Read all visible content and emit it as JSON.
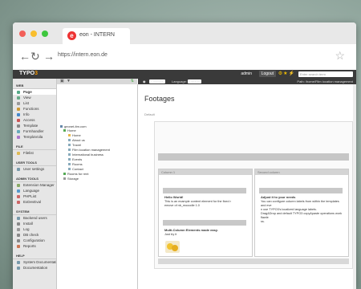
{
  "browser": {
    "tab_title": "eon - INTERN",
    "tab_icon": "e",
    "url": "https://intern.eon.de"
  },
  "typo3": {
    "logo_prefix": "TYPO",
    "logo_suffix": "3",
    "user": "admin",
    "logout": "Logout",
    "search_placeholder": "Enter search term"
  },
  "sidebar": {
    "sections": [
      {
        "title": "WEB",
        "items": [
          "Page",
          "View",
          "List",
          "Functions",
          "Info",
          "Access",
          "Template",
          "Formhandler",
          "TemplaVoila"
        ]
      },
      {
        "title": "FILE",
        "items": [
          "Filelist"
        ]
      },
      {
        "title": "USER TOOLS",
        "items": [
          "User settings"
        ]
      },
      {
        "title": "ADMIN TOOLS",
        "items": [
          "Extension Manager",
          "Language",
          "PHPList",
          "ExDevEval"
        ]
      },
      {
        "title": "SYSTEM",
        "items": [
          "Backend users",
          "Install",
          "Log",
          "DB check",
          "Configuration",
          "Reports"
        ]
      },
      {
        "title": "HELP",
        "items": [
          "System Documentation",
          "Documentation"
        ]
      }
    ]
  },
  "tree": {
    "nodes": [
      "geonet-itm.com",
      "Home",
      "Home",
      "About us",
      "Travel",
      "Film location management",
      "International business",
      "Events",
      "Rooms",
      "Contact",
      "Rooms for rent",
      "Storage"
    ]
  },
  "docheader": {
    "columns": "Columns",
    "language_label": "Language:",
    "language_value": "Default",
    "path": "Path: /home/Film location management"
  },
  "page": {
    "title": "Footages",
    "default_label": "Default",
    "col1_header": "Column 1",
    "col2_header": "Second column",
    "col1_heading": "Hello World!",
    "col1_text": "This is an example content element for the fixed r",
    "col1_text2": "emove of nb_mooodle 1.0",
    "col1_heading2": "Multi-Column Elements made easy.",
    "col1_text3": "Just try it",
    "col2_heading": "Adjust it to your needs",
    "col2_text": "You can configure column labels from within the templates and eve",
    "col2_text2": "n use TYPO3's localized language labels.",
    "col2_text3": "Drag&Drop and default TYPO3 copy&paste operations work flawle",
    "col2_text4": "ss."
  }
}
